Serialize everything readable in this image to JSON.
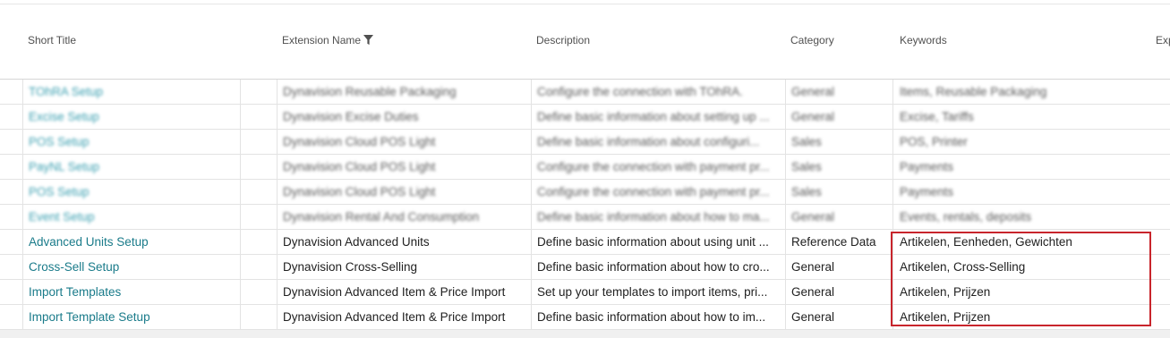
{
  "columns": {
    "short_title": "Short Title",
    "extension_name": "Extension Name",
    "description": "Description",
    "category": "Category",
    "keywords": "Keywords",
    "exp": "Exp"
  },
  "blurred_rows": [
    {
      "title": "TOhRA Setup",
      "ext": "Dynavision Reusable Packaging",
      "desc": "Configure the connection with TOhRA.",
      "cat": "General",
      "kw": "Items, Reusable Packaging"
    },
    {
      "title": "Excise Setup",
      "ext": "Dynavision Excise Duties",
      "desc": "Define basic information about setting up ...",
      "cat": "General",
      "kw": "Excise, Tariffs"
    },
    {
      "title": "POS Setup",
      "ext": "Dynavision Cloud POS Light",
      "desc": "Define basic information about configuri...",
      "cat": "Sales",
      "kw": "POS, Printer"
    },
    {
      "title": "PayNL Setup",
      "ext": "Dynavision Cloud POS Light",
      "desc": "Configure the connection with payment pr...",
      "cat": "Sales",
      "kw": "Payments"
    },
    {
      "title": "POS Setup",
      "ext": "Dynavision Cloud POS Light",
      "desc": "Configure the connection with payment pr...",
      "cat": "Sales",
      "kw": "Payments"
    },
    {
      "title": "Event Setup",
      "ext": "Dynavision Rental And Consumption",
      "desc": "Define basic information about how to ma...",
      "cat": "General",
      "kw": "Events, rentals, deposits"
    }
  ],
  "rows": [
    {
      "title": "Advanced Units Setup",
      "ext": "Dynavision Advanced Units",
      "desc": "Define basic information about using unit ...",
      "cat": "Reference Data",
      "kw": "Artikelen, Eenheden, Gewichten"
    },
    {
      "title": "Cross-Sell Setup",
      "ext": "Dynavision Cross-Selling",
      "desc": "Define basic information about how to cro...",
      "cat": "General",
      "kw": "Artikelen, Cross-Selling"
    },
    {
      "title": "Import Templates",
      "ext": "Dynavision Advanced Item & Price Import",
      "desc": "Set up your templates to import items, pri...",
      "cat": "General",
      "kw": "Artikelen, Prijzen"
    },
    {
      "title": "Import Template Setup",
      "ext": "Dynavision Advanced Item & Price Import",
      "desc": "Define basic information about how to im...",
      "cat": "General",
      "kw": "Artikelen, Prijzen"
    }
  ],
  "colors": {
    "link": "#1a7b8a",
    "highlight": "#c8252c"
  },
  "icons": {
    "filter": "filter-icon"
  }
}
